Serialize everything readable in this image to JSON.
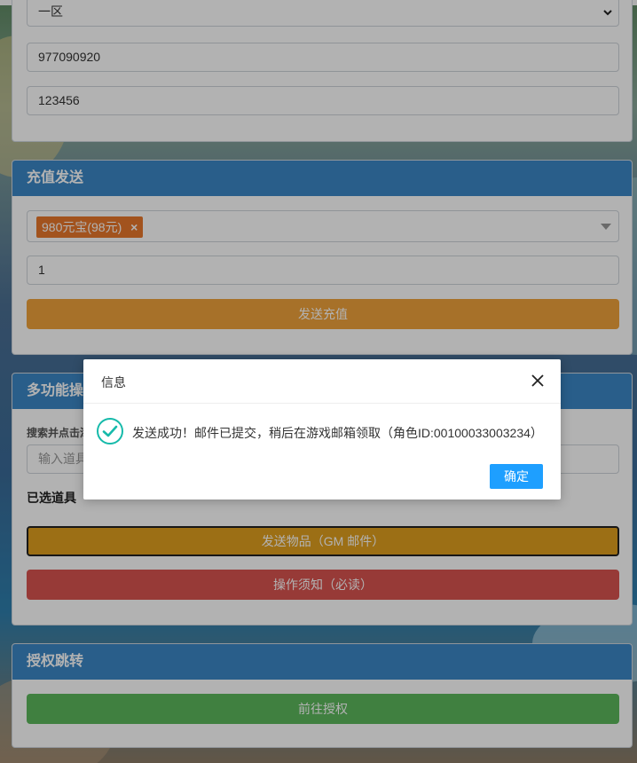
{
  "login": {
    "server_select": "一区",
    "role_id": "977090920",
    "password": "123456"
  },
  "recharge": {
    "title": "充值发送",
    "selected_tag": "980元宝(98元)",
    "tag_remove": "×",
    "quantity": "1",
    "send_button": "发送充值"
  },
  "multi": {
    "title": "多功能操",
    "search_label": "搜索并点击添",
    "search_placeholder": "输入道具",
    "selected_label": "已选道具",
    "send_items_button": "发送物品（GM 邮件）",
    "notice_button": "操作须知（必读）"
  },
  "auth": {
    "title": "授权跳转",
    "goto_button": "前往授权"
  },
  "dialog": {
    "title": "信息",
    "message": "发送成功！邮件已提交，稍后在游戏邮箱领取（角色ID:00100033003234）",
    "ok_button": "确定"
  },
  "colors": {
    "header_blue": "#3b87c6",
    "orange_button": "#f0a33c",
    "tag_orange": "#e8782c",
    "gold_button": "#e0a01f",
    "red_button": "#d9534f",
    "green_button": "#5cb85c",
    "dialog_ok": "#1e9fff",
    "success_icon": "#16baaa"
  },
  "icons": {
    "close": "close-icon",
    "success": "check-circle-icon",
    "dropdown": "chevron-down-icon"
  }
}
